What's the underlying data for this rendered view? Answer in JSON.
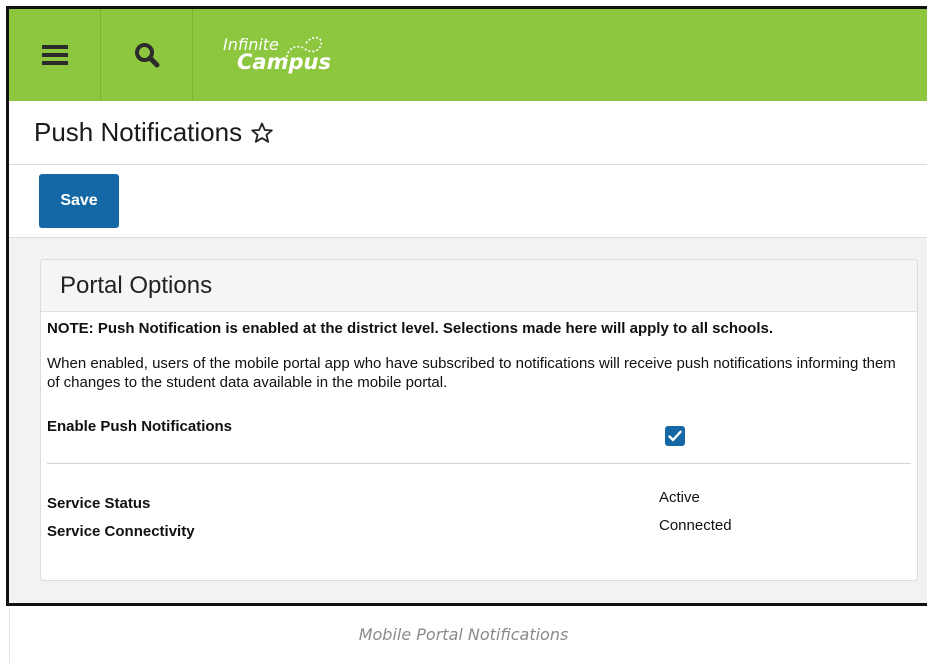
{
  "app": {
    "logo_top": "Infinite",
    "logo_bottom": "Campus",
    "menu_icon": "hamburger-menu-icon",
    "search_icon": "search-icon",
    "brand_color": "#8dc63f",
    "accent_color": "#1568a6"
  },
  "page": {
    "title": "Push Notifications",
    "favorite_icon": "star-outline-icon"
  },
  "toolbar": {
    "save_label": "Save"
  },
  "panel": {
    "title": "Portal Options",
    "note": "NOTE: Push Notification is enabled at the district level. Selections made here will apply to all schools.",
    "description": "When enabled, users of the mobile portal app who have subscribed to notifications will receive push notifications informing them of changes to the student data available in the mobile portal.",
    "enable_label": "Enable Push Notifications",
    "enable_checked": true,
    "service_status_label": "Service Status",
    "service_status_value": "Active",
    "service_connectivity_label": "Service Connectivity",
    "service_connectivity_value": "Connected"
  },
  "caption": "Mobile Portal Notifications"
}
